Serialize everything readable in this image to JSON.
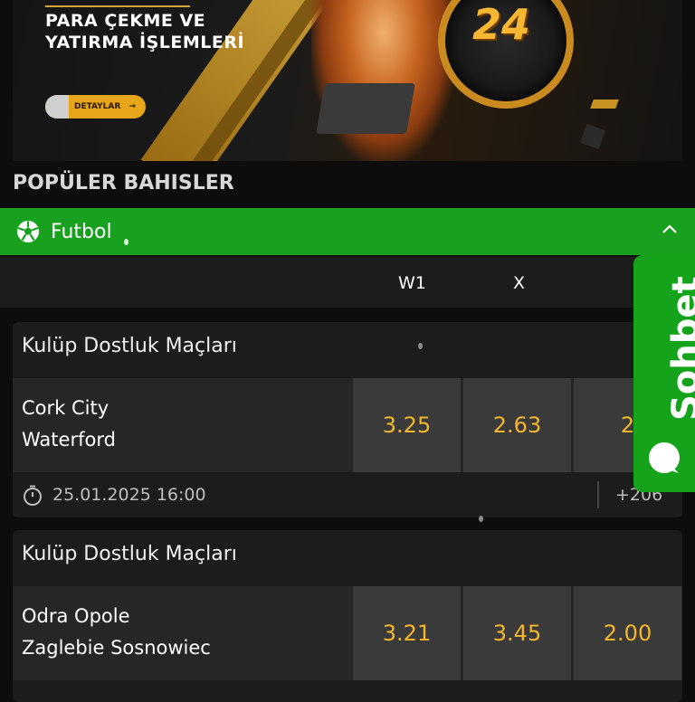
{
  "banner": {
    "title_line1": "PARA ÇEKME VE",
    "title_line2": "YATIRMA İŞLEMLERİ",
    "details_label": "DETAYLAR",
    "details_arrow": "→",
    "clock_number": "24"
  },
  "section": {
    "title": "POPÜLER BAHISLER"
  },
  "sport": {
    "label": "Futbol",
    "icon": "soccer-ball-icon",
    "color": "#18a01f"
  },
  "odds_header": {
    "w1": "W1",
    "x": "X"
  },
  "matches": [
    {
      "league": "Kulüp Dostluk Maçları",
      "team1": "Cork City",
      "team2": "Waterford",
      "odds": [
        "3.25",
        "2.63",
        "2"
      ],
      "datetime": "25.01.2025 16:00",
      "more": "+206"
    },
    {
      "league": "Kulüp Dostluk Maçları",
      "team1": "Odra Opole",
      "team2": "Zaglebie Sosnowiec",
      "odds": [
        "3.21",
        "3.45",
        "2.00"
      ]
    }
  ],
  "chat": {
    "label": "Sohbet",
    "color": "#15a31c"
  },
  "colors": {
    "odd_text": "#f3b62b",
    "accent_gold": "#e7a51a"
  }
}
